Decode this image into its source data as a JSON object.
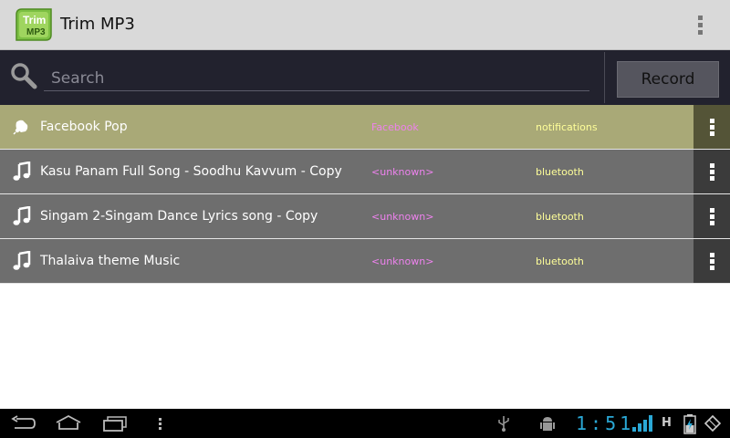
{
  "app": {
    "logo_text_top": "Trim",
    "logo_text_bottom": "MP3",
    "title": "Trim MP3"
  },
  "search": {
    "placeholder": "Search"
  },
  "record_button": "Record",
  "rows": [
    {
      "title": "Facebook Pop",
      "artist": "Facebook",
      "album": "notifications",
      "icon": "notification-bell-icon",
      "selected": true
    },
    {
      "title": "Kasu Panam Full Song - Soodhu Kavvum - Copy",
      "artist": "<unknown>",
      "album": "bluetooth",
      "icon": "music-note-icon",
      "selected": false
    },
    {
      "title": "Singam 2-Singam Dance Lyrics song - Copy",
      "artist": "<unknown>",
      "album": "bluetooth",
      "icon": "music-note-icon",
      "selected": false
    },
    {
      "title": "Thalaiva theme Music",
      "artist": "<unknown>",
      "album": "bluetooth",
      "icon": "music-note-icon",
      "selected": false
    }
  ],
  "status": {
    "clock": "1:51",
    "network_type": "H"
  },
  "colors": {
    "actionbar": "#d9d9d9",
    "searchbar": "#22222e",
    "row": "#6e6e6e",
    "row_selected": "#a9a977",
    "artist_text": "#ee82ee",
    "album_text": "#ffff99",
    "clock": "#2aa8d6"
  }
}
